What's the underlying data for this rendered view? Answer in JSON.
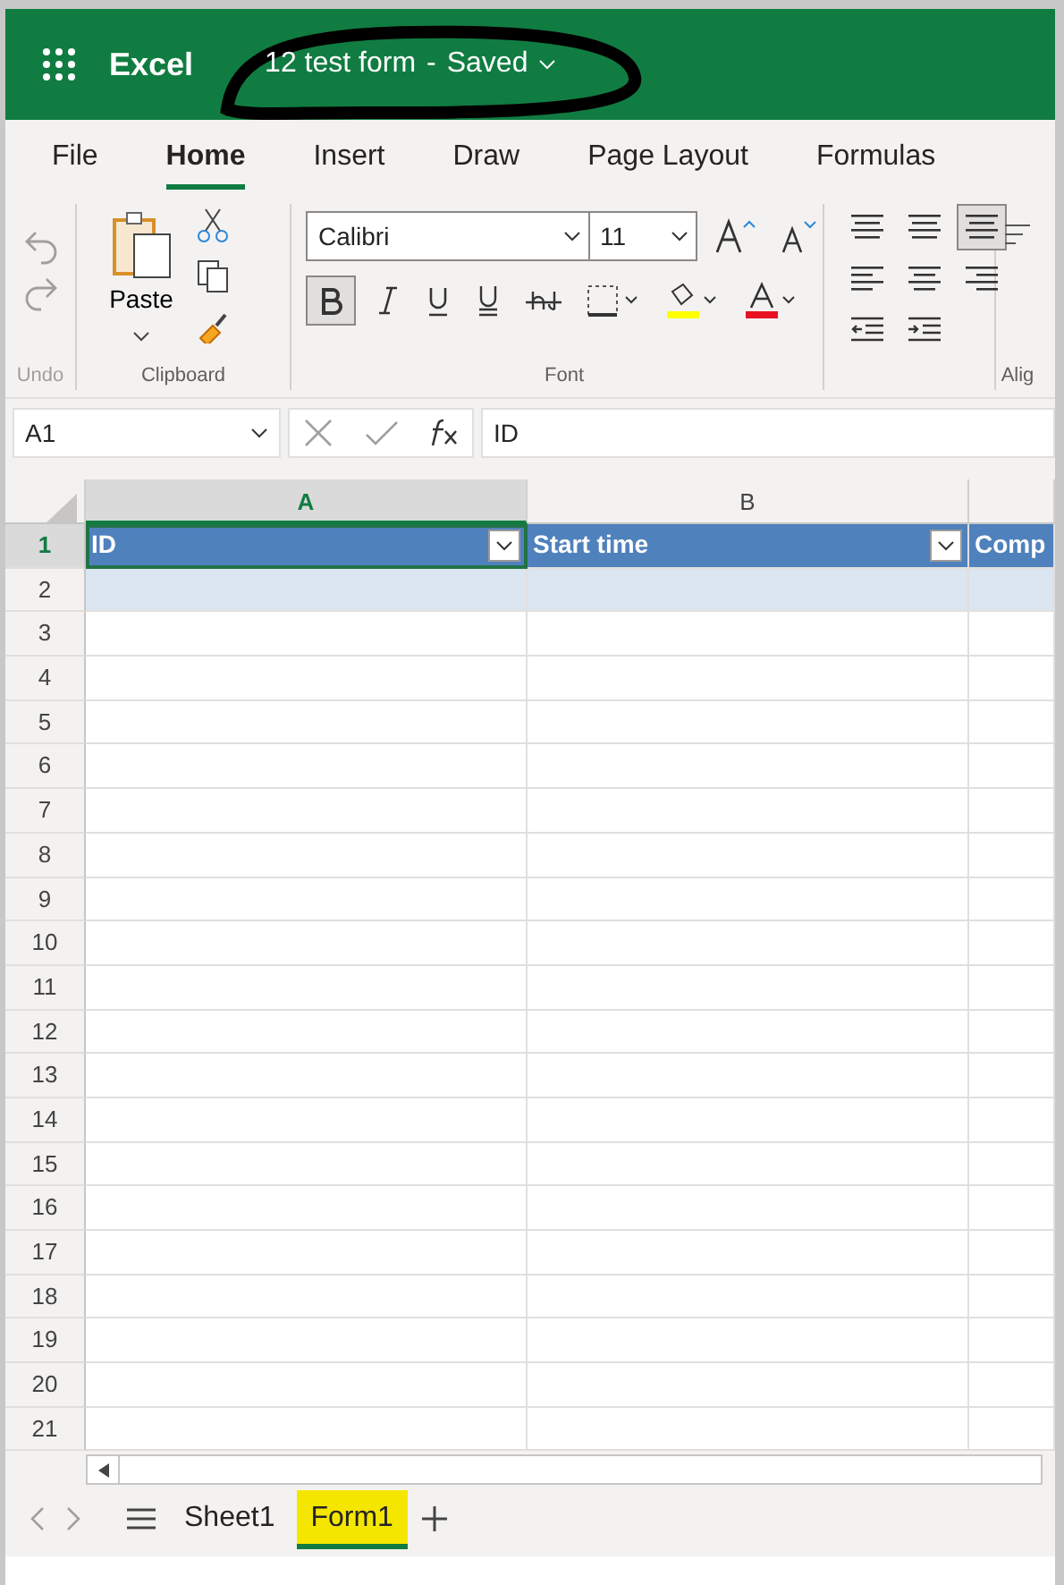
{
  "header": {
    "app": "Excel",
    "document": "12 test form",
    "separator": "-",
    "status": "Saved"
  },
  "ribbon_tabs": [
    {
      "label": "File",
      "selected": false
    },
    {
      "label": "Home",
      "selected": true
    },
    {
      "label": "Insert",
      "selected": false
    },
    {
      "label": "Draw",
      "selected": false
    },
    {
      "label": "Page Layout",
      "selected": false
    },
    {
      "label": "Formulas",
      "selected": false
    }
  ],
  "ribbon": {
    "undo_label": "Undo",
    "paste_label": "Paste",
    "clipboard_label": "Clipboard",
    "font_name": "Calibri",
    "font_size": "11",
    "bold": true,
    "font_label": "Font",
    "align_bottom": true,
    "alignment_label": "Alig"
  },
  "formula_bar": {
    "name_box": "A1",
    "formula": "ID"
  },
  "grid": {
    "columns": [
      {
        "label": "A",
        "selected": true
      },
      {
        "label": "B",
        "selected": false
      }
    ],
    "header_cells": [
      "ID",
      "Start time",
      "Comp"
    ],
    "rows": [
      {
        "label": "1",
        "selected": true
      },
      {
        "label": "2",
        "selected": false
      },
      {
        "label": "3",
        "selected": false
      },
      {
        "label": "4",
        "selected": false
      },
      {
        "label": "5",
        "selected": false
      },
      {
        "label": "6",
        "selected": false
      },
      {
        "label": "7",
        "selected": false
      },
      {
        "label": "8",
        "selected": false
      },
      {
        "label": "9",
        "selected": false
      },
      {
        "label": "10",
        "selected": false
      },
      {
        "label": "11",
        "selected": false
      },
      {
        "label": "12",
        "selected": false
      },
      {
        "label": "13",
        "selected": false
      },
      {
        "label": "14",
        "selected": false
      },
      {
        "label": "15",
        "selected": false
      },
      {
        "label": "16",
        "selected": false
      },
      {
        "label": "17",
        "selected": false
      },
      {
        "label": "18",
        "selected": false
      },
      {
        "label": "19",
        "selected": false
      },
      {
        "label": "20",
        "selected": false
      },
      {
        "label": "21",
        "selected": false
      }
    ]
  },
  "sheet_tabs": [
    {
      "label": "Sheet1",
      "selected": false,
      "highlighted": false
    },
    {
      "label": "Form1",
      "selected": true,
      "highlighted": true
    }
  ]
}
